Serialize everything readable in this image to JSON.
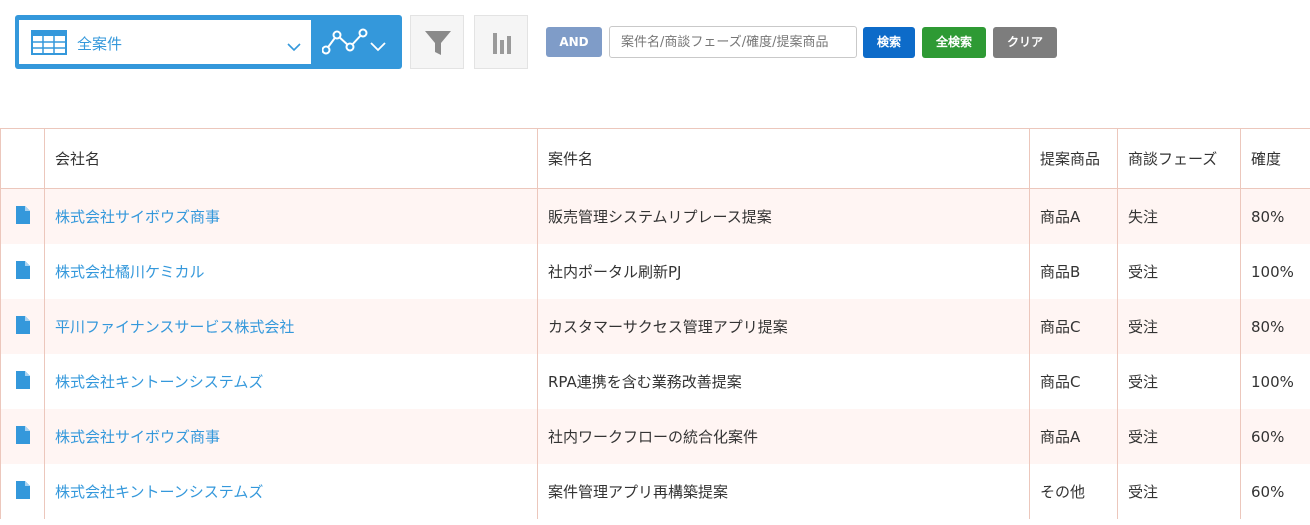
{
  "toolbar": {
    "view_name": "全案件",
    "and_label": "AND",
    "search_placeholder": "案件名/商談フェーズ/確度/提案商品",
    "search_label": "検索",
    "all_search_label": "全検索",
    "clear_label": "クリア",
    "accent_color": "#3498db"
  },
  "table": {
    "headers": [
      "会社名",
      "案件名",
      "提案商品",
      "商談フェーズ",
      "確度"
    ],
    "rows": [
      {
        "company": "株式会社サイボウズ商事",
        "deal": "販売管理システムリプレース提案",
        "product": "商品A",
        "phase": "失注",
        "probability": "80%"
      },
      {
        "company": "株式会社橘川ケミカル",
        "deal": "社内ポータル刷新PJ",
        "product": "商品B",
        "phase": "受注",
        "probability": "100%"
      },
      {
        "company": "平川ファイナンスサービス株式会社",
        "deal": "カスタマーサクセス管理アプリ提案",
        "product": "商品C",
        "phase": "受注",
        "probability": "80%"
      },
      {
        "company": "株式会社キントーンシステムズ",
        "deal": "RPA連携を含む業務改善提案",
        "product": "商品C",
        "phase": "受注",
        "probability": "100%"
      },
      {
        "company": "株式会社サイボウズ商事",
        "deal": "社内ワークフローの統合化案件",
        "product": "商品A",
        "phase": "受注",
        "probability": "60%"
      },
      {
        "company": "株式会社キントーンシステムズ",
        "deal": "案件管理アプリ再構築提案",
        "product": "その他",
        "phase": "受注",
        "probability": "60%"
      }
    ]
  }
}
